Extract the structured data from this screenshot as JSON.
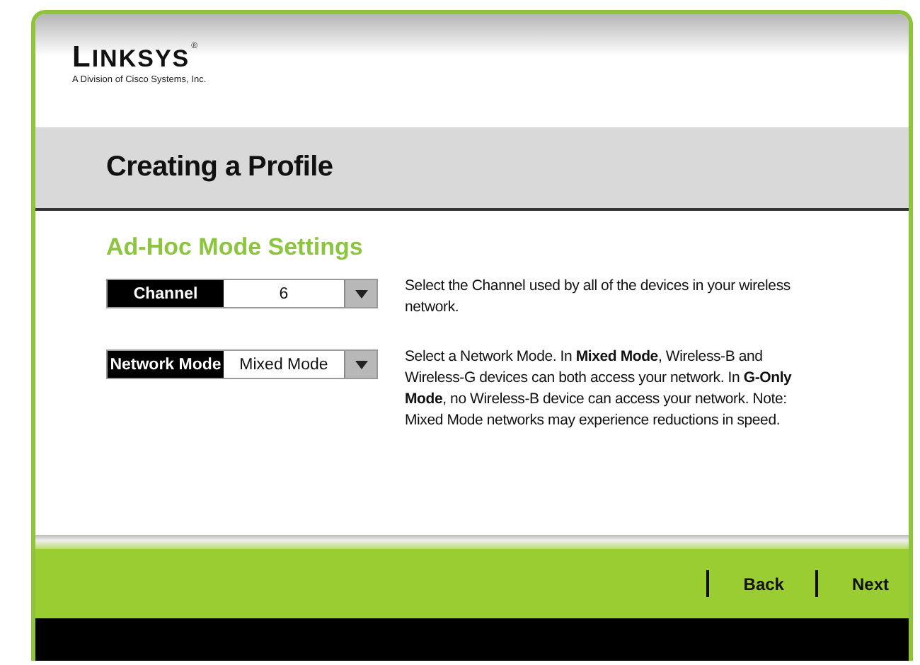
{
  "logo": {
    "brand": "LINKSYS",
    "mark": "®",
    "tagline": "A Division of Cisco Systems, Inc."
  },
  "title": "Creating a Profile",
  "section": "Ad-Hoc Mode Settings",
  "settings": [
    {
      "label": "Channel",
      "value": "6",
      "description": "Select the Channel used by all of the devices in your wireless network."
    },
    {
      "label": "Network Mode",
      "value": "Mixed Mode",
      "description": "Select a Network Mode. In **Mixed Mode**, Wireless-B and Wireless-G devices can both access your network. In **G-Only Mode**, no Wireless-B device can access your network. Note: Mixed Mode networks may experience reductions in speed."
    }
  ],
  "buttons": [
    "Back",
    "Next"
  ]
}
